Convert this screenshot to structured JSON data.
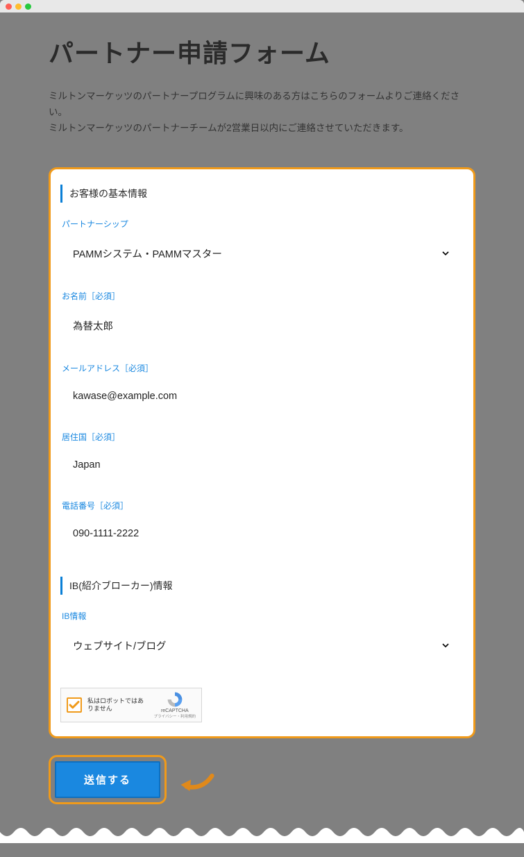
{
  "page": {
    "title": "パートナー申請フォーム",
    "description_line1": "ミルトンマーケッツのパートナープログラムに興味のある方はこちらのフォームよりご連絡ください。",
    "description_line2": "ミルトンマーケッツのパートナーチームが2営業日以内にご連絡させていただきます。"
  },
  "form": {
    "section_basic": "お客様の基本情報",
    "section_ib": "IB(紹介ブローカー)情報",
    "fields": {
      "partnership": {
        "label": "パートナーシップ",
        "value": "PAMMシステム・PAMMマスター"
      },
      "name": {
        "label": "お名前［必須］",
        "value": "為替太郎"
      },
      "email": {
        "label": "メールアドレス［必須］",
        "value": "kawase@example.com"
      },
      "country": {
        "label": "居住国［必須］",
        "value": "Japan"
      },
      "phone": {
        "label": "電話番号［必須］",
        "value": "090-1111-2222"
      },
      "ib_info": {
        "label": "IB情報",
        "value": "ウェブサイト/ブログ"
      }
    },
    "recaptcha": {
      "text": "私はロボットではありません",
      "brand": "reCAPTCHA",
      "terms": "プライバシー・利用規約"
    },
    "submit_label": "送信する"
  }
}
